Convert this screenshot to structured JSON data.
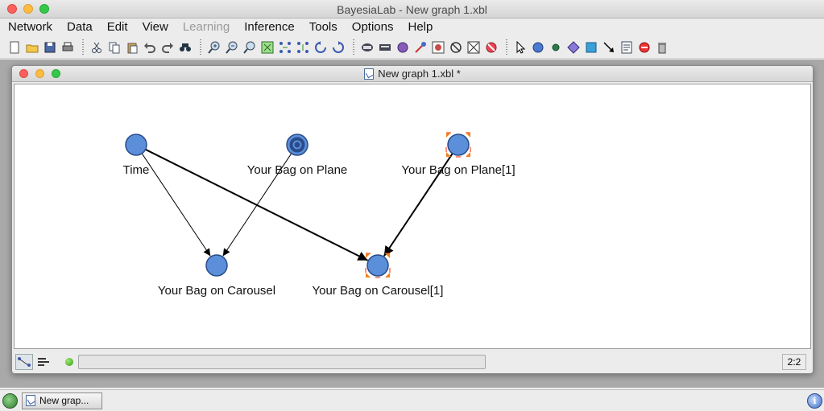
{
  "app": {
    "title": "BayesiaLab - New graph 1.xbl"
  },
  "menu": [
    {
      "label": "Network",
      "disabled": false
    },
    {
      "label": "Data",
      "disabled": false
    },
    {
      "label": "Edit",
      "disabled": false
    },
    {
      "label": "View",
      "disabled": false
    },
    {
      "label": "Learning",
      "disabled": true
    },
    {
      "label": "Inference",
      "disabled": false
    },
    {
      "label": "Tools",
      "disabled": false
    },
    {
      "label": "Options",
      "disabled": false
    },
    {
      "label": "Help",
      "disabled": false
    }
  ],
  "toolbar": {
    "groups": [
      [
        "new-file-icon",
        "open-folder-icon",
        "save-icon",
        "print-icon"
      ],
      [
        "cut-icon",
        "copy-icon",
        "paste-icon",
        "undo-icon",
        "redo-icon",
        "find-icon"
      ],
      [
        "zoom-in-icon",
        "zoom-out-icon",
        "zoom-reset-icon",
        "fit-window-icon",
        "distribute-icon",
        "layout-icon",
        "rotate-left-icon",
        "rotate-right-icon"
      ],
      [
        "node-monitor-icon",
        "node-editor-icon",
        "target-node-icon",
        "arc-icon",
        "node-display-icon",
        "hide-node-icon",
        "hide-arc-icon",
        "forbidden-icon"
      ],
      [
        "selection-arrow-icon",
        "node-creation-icon",
        "node-small-icon",
        "decision-node-icon",
        "utility-node-icon",
        "arc-creation-icon",
        "note-icon",
        "delete-icon",
        "trash-icon"
      ]
    ]
  },
  "window": {
    "title": "New graph 1.xbl *"
  },
  "graph": {
    "colors": {
      "node_fill": "#5b8fd9",
      "node_stroke": "#2a4c8a",
      "selection": "#ff2200",
      "target": "#2a4c8a"
    },
    "nodes": [
      {
        "id": "time",
        "label": "Time",
        "type": "normal",
        "selected": false
      },
      {
        "id": "plane",
        "label": "Your Bag on Plane",
        "type": "target",
        "selected": false
      },
      {
        "id": "plane1",
        "label": "Your Bag on Plane[1]",
        "type": "normal",
        "selected": true
      },
      {
        "id": "carousel",
        "label": "Your Bag on Carousel",
        "type": "normal",
        "selected": false
      },
      {
        "id": "carousel1",
        "label": "Your Bag on Carousel[1]",
        "type": "normal",
        "selected": true
      }
    ],
    "arcs": [
      {
        "from": "time",
        "to": "carousel",
        "weight": "thin"
      },
      {
        "from": "plane",
        "to": "carousel",
        "weight": "thin"
      },
      {
        "from": "time",
        "to": "carousel1",
        "weight": "bold"
      },
      {
        "from": "plane1",
        "to": "carousel1",
        "weight": "bold"
      }
    ]
  },
  "status": {
    "mode_buttons": [
      "network-mode-icon",
      "list-mode-icon"
    ],
    "zoom": "2:2"
  },
  "taskbar": {
    "task_label": "New grap..."
  }
}
